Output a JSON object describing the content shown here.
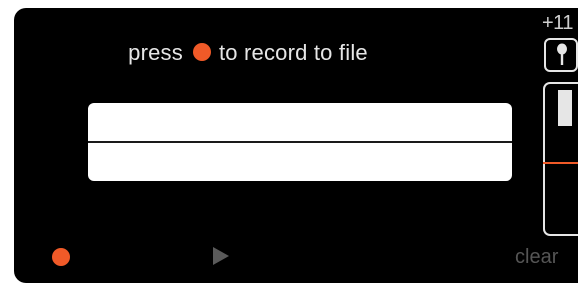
{
  "prompt": {
    "before": "press",
    "after": "to record to file"
  },
  "input_gain": {
    "label": "+11"
  },
  "level_meter": {
    "fill_fraction": 0.75,
    "threshold_fraction": 0.5
  },
  "controls": {
    "clear_label": "clear"
  },
  "icons": {
    "record": "record-dot-icon",
    "play": "play-icon",
    "microphone": "microphone-icon"
  },
  "colors": {
    "accent": "#f05a28",
    "panel": "#000000",
    "waveform_bg": "#ffffff",
    "disabled": "#555555"
  }
}
